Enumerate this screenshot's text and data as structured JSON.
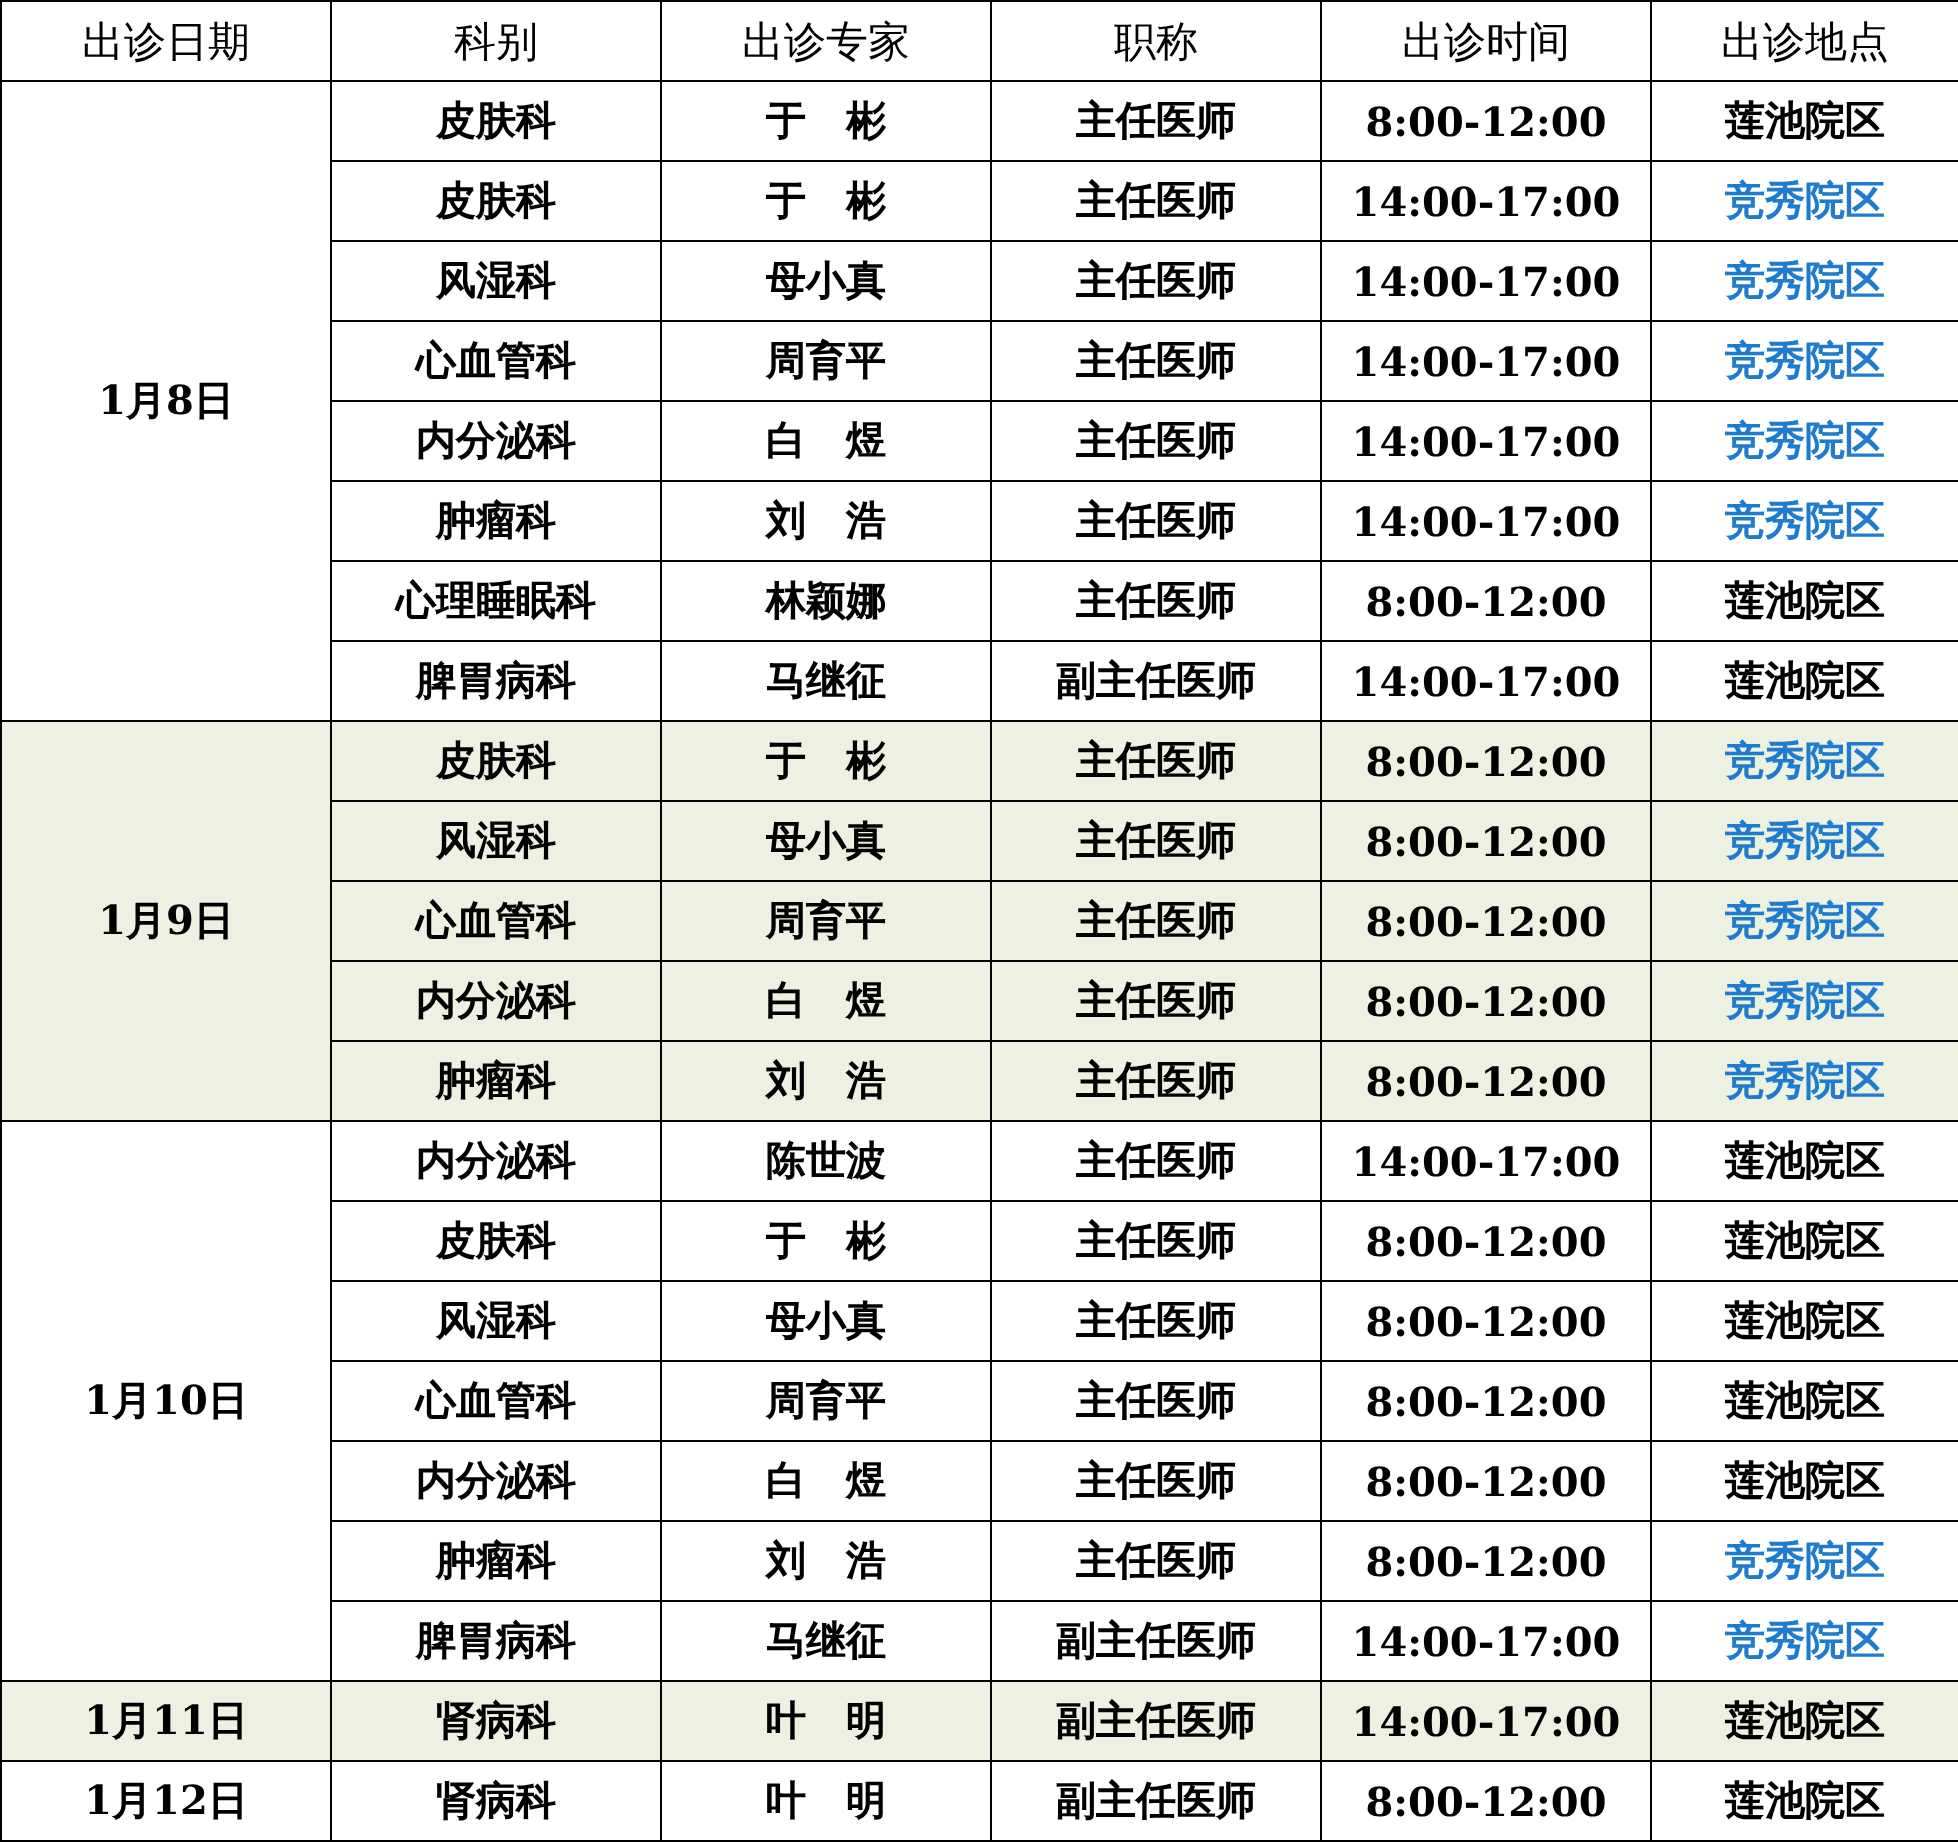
{
  "columns": [
    "出诊日期",
    "科别",
    "出诊专家",
    "职称",
    "出诊时间",
    "出诊地点"
  ],
  "groups": [
    {
      "date": "1月8日",
      "shaded": false,
      "rows": [
        {
          "department": "皮肤科",
          "doctor": "于　彬",
          "title": "主任医师",
          "time": "8:00-12:00",
          "location": "莲池院区",
          "color": "#000000"
        },
        {
          "department": "皮肤科",
          "doctor": "于　彬",
          "title": "主任医师",
          "time": "14:00-17:00",
          "location": "竞秀院区",
          "color": "#1e7bd0"
        },
        {
          "department": "风湿科",
          "doctor": "母小真",
          "title": "主任医师",
          "time": "14:00-17:00",
          "location": "竞秀院区",
          "color": "#1e7bd0"
        },
        {
          "department": "心血管科",
          "doctor": "周育平",
          "title": "主任医师",
          "time": "14:00-17:00",
          "location": "竞秀院区",
          "color": "#1e7bd0"
        },
        {
          "department": "内分泌科",
          "doctor": "白　煜",
          "title": "主任医师",
          "time": "14:00-17:00",
          "location": "竞秀院区",
          "color": "#1e7bd0"
        },
        {
          "department": "肿瘤科",
          "doctor": "刘　浩",
          "title": "主任医师",
          "time": "14:00-17:00",
          "location": "竞秀院区",
          "color": "#1e7bd0"
        },
        {
          "department": "心理睡眠科",
          "doctor": "林颖娜",
          "title": "主任医师",
          "time": "8:00-12:00",
          "location": "莲池院区",
          "color": "#000000"
        },
        {
          "department": "脾胃病科",
          "doctor": "马继征",
          "title": "副主任医师",
          "time": "14:00-17:00",
          "location": "莲池院区",
          "color": "#000000"
        }
      ]
    },
    {
      "date": "1月9日",
      "shaded": true,
      "rows": [
        {
          "department": "皮肤科",
          "doctor": "于　彬",
          "title": "主任医师",
          "time": "8:00-12:00",
          "location": "竞秀院区",
          "color": "#1e7bd0"
        },
        {
          "department": "风湿科",
          "doctor": "母小真",
          "title": "主任医师",
          "time": "8:00-12:00",
          "location": "竞秀院区",
          "color": "#1e7bd0"
        },
        {
          "department": "心血管科",
          "doctor": "周育平",
          "title": "主任医师",
          "time": "8:00-12:00",
          "location": "竞秀院区",
          "color": "#1e7bd0"
        },
        {
          "department": "内分泌科",
          "doctor": "白　煜",
          "title": "主任医师",
          "time": "8:00-12:00",
          "location": "竞秀院区",
          "color": "#1e7bd0"
        },
        {
          "department": "肿瘤科",
          "doctor": "刘　浩",
          "title": "主任医师",
          "time": "8:00-12:00",
          "location": "竞秀院区",
          "color": "#1e7bd0"
        }
      ]
    },
    {
      "date": "1月10日",
      "shaded": false,
      "rows": [
        {
          "department": "内分泌科",
          "doctor": "陈世波",
          "title": "主任医师",
          "time": "14:00-17:00",
          "location": "莲池院区",
          "color": "#000000"
        },
        {
          "department": "皮肤科",
          "doctor": "于　彬",
          "title": "主任医师",
          "time": "8:00-12:00",
          "location": "莲池院区",
          "color": "#000000"
        },
        {
          "department": "风湿科",
          "doctor": "母小真",
          "title": "主任医师",
          "time": "8:00-12:00",
          "location": "莲池院区",
          "color": "#000000"
        },
        {
          "department": "心血管科",
          "doctor": "周育平",
          "title": "主任医师",
          "time": "8:00-12:00",
          "location": "莲池院区",
          "color": "#000000"
        },
        {
          "department": "内分泌科",
          "doctor": "白　煜",
          "title": "主任医师",
          "time": "8:00-12:00",
          "location": "莲池院区",
          "color": "#000000"
        },
        {
          "department": "肿瘤科",
          "doctor": "刘　浩",
          "title": "主任医师",
          "time": "8:00-12:00",
          "location": "竞秀院区",
          "color": "#1e7bd0"
        },
        {
          "department": "脾胃病科",
          "doctor": "马继征",
          "title": "副主任医师",
          "time": "14:00-17:00",
          "location": "竞秀院区",
          "color": "#1e7bd0"
        }
      ]
    },
    {
      "date": "1月11日",
      "shaded": true,
      "rows": [
        {
          "department": "肾病科",
          "doctor": "叶　明",
          "title": "副主任医师",
          "time": "14:00-17:00",
          "location": "莲池院区",
          "color": "#000000"
        }
      ]
    },
    {
      "date": "1月12日",
      "shaded": false,
      "rows": [
        {
          "department": "肾病科",
          "doctor": "叶　明",
          "title": "副主任医师",
          "time": "8:00-12:00",
          "location": "莲池院区",
          "color": "#000000"
        }
      ]
    }
  ]
}
